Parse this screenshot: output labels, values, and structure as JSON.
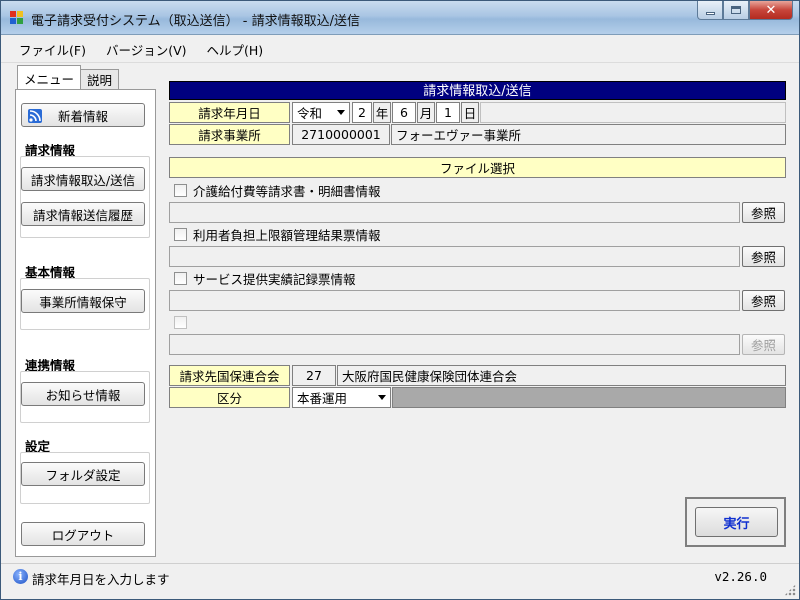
{
  "window": {
    "title": "電子請求受付システム（取込送信） - 請求情報取込/送信",
    "close_glyph": "✕"
  },
  "menubar": {
    "items": [
      "ファイル(F)",
      "バージョン(V)",
      "ヘルプ(H)"
    ]
  },
  "left_tabs": {
    "menu": "メニュー",
    "help": "説明"
  },
  "sidebar": {
    "news_button": "新着情報",
    "billing_section": "請求情報",
    "billing_import_button": "請求情報取込/送信",
    "billing_history_button": "請求情報送信履歴",
    "basic_section": "基本情報",
    "office_info_button": "事業所情報保守",
    "link_section": "連携情報",
    "notice_button": "お知らせ情報",
    "settings_section": "設定",
    "folder_button": "フォルダ設定",
    "logout_button": "ログアウト"
  },
  "main": {
    "header": "請求情報取込/送信",
    "billing_month_label": "請求年月日",
    "era": "令和",
    "year": "2",
    "year_unit": "年",
    "month": "6",
    "month_unit": "月",
    "day": "1",
    "day_unit": "日",
    "office_label": "請求事業所",
    "office_code": "2710000001",
    "office_name": "フォーエヴァー事業所",
    "file_select_header": "ファイル選択",
    "files": [
      {
        "label": "介護給付費等請求書・明細書情報",
        "path": "",
        "ref": "参照",
        "enabled": true
      },
      {
        "label": "利用者負担上限額管理結果票情報",
        "path": "",
        "ref": "参照",
        "enabled": true
      },
      {
        "label": "サービス提供実績記録票情報",
        "path": "",
        "ref": "参照",
        "enabled": true
      },
      {
        "label": "",
        "path": "",
        "ref": "参照",
        "enabled": false
      }
    ],
    "destination_label": "請求先国保連合会",
    "destination_code": "27",
    "destination_name": "大阪府国民健康保険団体連合会",
    "category_label": "区分",
    "category_value": "本番運用",
    "execute_button": "実行"
  },
  "statusbar": {
    "message": "請求年月日を入力します",
    "version": "v2.26.0"
  },
  "colors": {
    "header_bg": "#00007f",
    "label_bg": "#ffffc4",
    "execute_text": "#1030d0"
  }
}
